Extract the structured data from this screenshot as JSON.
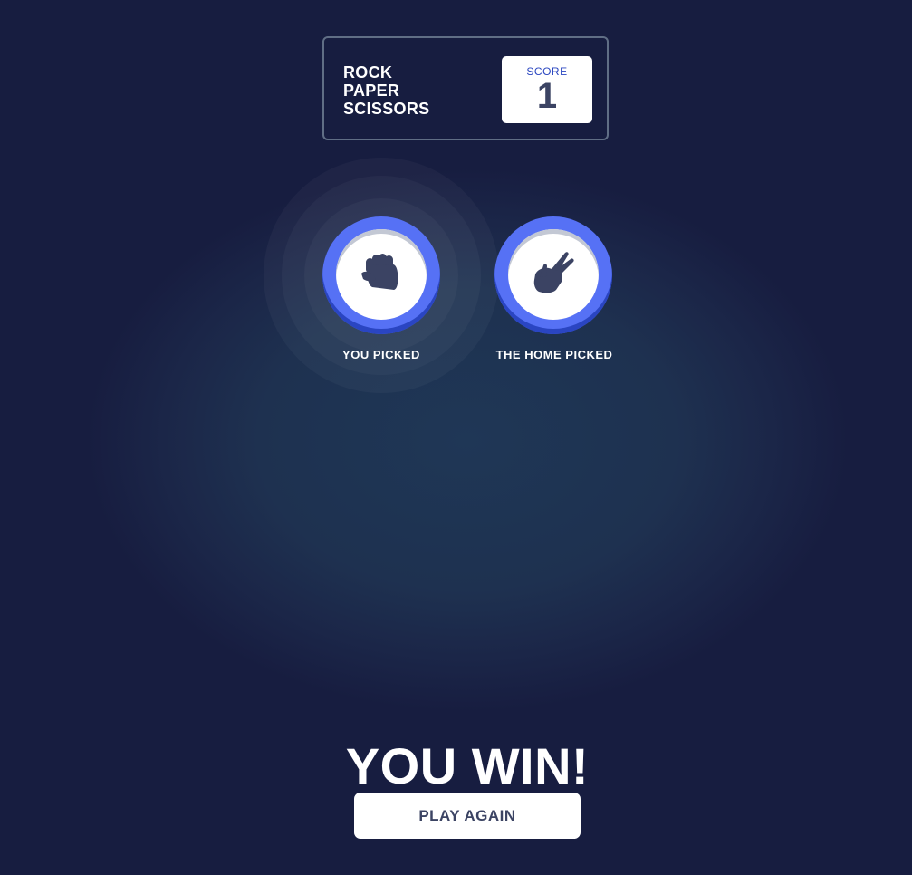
{
  "header": {
    "title_lines": [
      "ROCK",
      "PAPER",
      "SCISSORS"
    ],
    "score_label": "SCORE",
    "score_value": "1"
  },
  "player_pick": {
    "label": "YOU PICKED",
    "choice": "rock",
    "icon": "rock-fist-icon",
    "ring_color": "#5671f5",
    "winner": true
  },
  "house_pick": {
    "label": "THE HOME PICKED",
    "choice": "scissors",
    "icon": "scissors-hand-icon",
    "ring_color": "#5671f5"
  },
  "result": {
    "message": "YOU WIN!",
    "play_again_label": "PLAY AGAIN"
  },
  "colors": {
    "background": "#1e3150",
    "header_border": "#606e85",
    "score_label": "#2a46c0",
    "dark_text": "#3b4363",
    "chip_ring": "#5671f5",
    "chip_shadow": "#2a45c2"
  }
}
